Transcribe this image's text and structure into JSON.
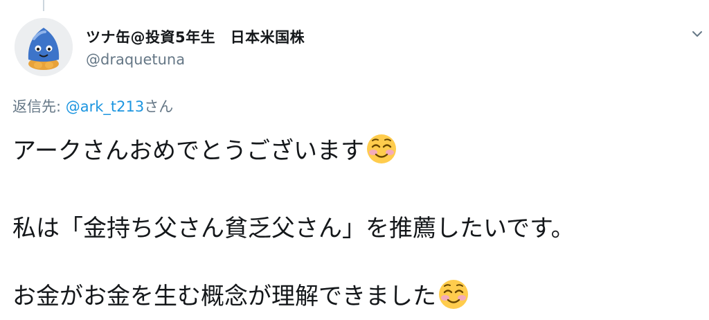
{
  "tweet": {
    "display_name": "ツナ缶@投資5年生　日本米国株",
    "handle": "@draquetuna",
    "reply_prefix": "返信先: ",
    "reply_mention": "@ark_t213",
    "reply_suffix": "さん",
    "lines": [
      "アークさんおめでとうございます",
      "私は「金持ち父さん貧乏父さん」を推薦したいです。",
      "お金がお金を生む概念が理解できました"
    ],
    "emoji": "smiling-face-with-blushing-cheeks"
  },
  "colors": {
    "text": "#14171a",
    "secondary": "#657786",
    "link": "#1b95e0",
    "divider": "#ccd6dd"
  }
}
